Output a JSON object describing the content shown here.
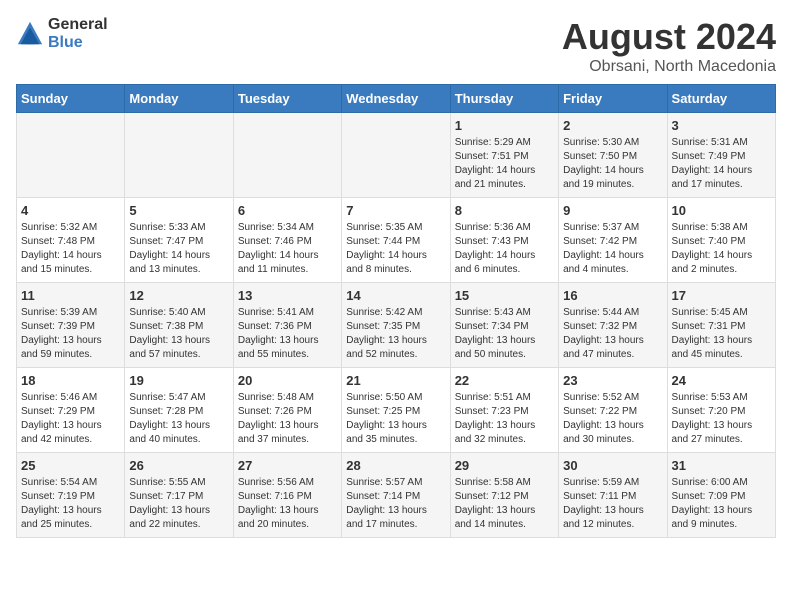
{
  "logo": {
    "general": "General",
    "blue": "Blue"
  },
  "title": "August 2024",
  "subtitle": "Obrsani, North Macedonia",
  "weekdays": [
    "Sunday",
    "Monday",
    "Tuesday",
    "Wednesday",
    "Thursday",
    "Friday",
    "Saturday"
  ],
  "weeks": [
    [
      {
        "day": "",
        "content": ""
      },
      {
        "day": "",
        "content": ""
      },
      {
        "day": "",
        "content": ""
      },
      {
        "day": "",
        "content": ""
      },
      {
        "day": "1",
        "content": "Sunrise: 5:29 AM\nSunset: 7:51 PM\nDaylight: 14 hours\nand 21 minutes."
      },
      {
        "day": "2",
        "content": "Sunrise: 5:30 AM\nSunset: 7:50 PM\nDaylight: 14 hours\nand 19 minutes."
      },
      {
        "day": "3",
        "content": "Sunrise: 5:31 AM\nSunset: 7:49 PM\nDaylight: 14 hours\nand 17 minutes."
      }
    ],
    [
      {
        "day": "4",
        "content": "Sunrise: 5:32 AM\nSunset: 7:48 PM\nDaylight: 14 hours\nand 15 minutes."
      },
      {
        "day": "5",
        "content": "Sunrise: 5:33 AM\nSunset: 7:47 PM\nDaylight: 14 hours\nand 13 minutes."
      },
      {
        "day": "6",
        "content": "Sunrise: 5:34 AM\nSunset: 7:46 PM\nDaylight: 14 hours\nand 11 minutes."
      },
      {
        "day": "7",
        "content": "Sunrise: 5:35 AM\nSunset: 7:44 PM\nDaylight: 14 hours\nand 8 minutes."
      },
      {
        "day": "8",
        "content": "Sunrise: 5:36 AM\nSunset: 7:43 PM\nDaylight: 14 hours\nand 6 minutes."
      },
      {
        "day": "9",
        "content": "Sunrise: 5:37 AM\nSunset: 7:42 PM\nDaylight: 14 hours\nand 4 minutes."
      },
      {
        "day": "10",
        "content": "Sunrise: 5:38 AM\nSunset: 7:40 PM\nDaylight: 14 hours\nand 2 minutes."
      }
    ],
    [
      {
        "day": "11",
        "content": "Sunrise: 5:39 AM\nSunset: 7:39 PM\nDaylight: 13 hours\nand 59 minutes."
      },
      {
        "day": "12",
        "content": "Sunrise: 5:40 AM\nSunset: 7:38 PM\nDaylight: 13 hours\nand 57 minutes."
      },
      {
        "day": "13",
        "content": "Sunrise: 5:41 AM\nSunset: 7:36 PM\nDaylight: 13 hours\nand 55 minutes."
      },
      {
        "day": "14",
        "content": "Sunrise: 5:42 AM\nSunset: 7:35 PM\nDaylight: 13 hours\nand 52 minutes."
      },
      {
        "day": "15",
        "content": "Sunrise: 5:43 AM\nSunset: 7:34 PM\nDaylight: 13 hours\nand 50 minutes."
      },
      {
        "day": "16",
        "content": "Sunrise: 5:44 AM\nSunset: 7:32 PM\nDaylight: 13 hours\nand 47 minutes."
      },
      {
        "day": "17",
        "content": "Sunrise: 5:45 AM\nSunset: 7:31 PM\nDaylight: 13 hours\nand 45 minutes."
      }
    ],
    [
      {
        "day": "18",
        "content": "Sunrise: 5:46 AM\nSunset: 7:29 PM\nDaylight: 13 hours\nand 42 minutes."
      },
      {
        "day": "19",
        "content": "Sunrise: 5:47 AM\nSunset: 7:28 PM\nDaylight: 13 hours\nand 40 minutes."
      },
      {
        "day": "20",
        "content": "Sunrise: 5:48 AM\nSunset: 7:26 PM\nDaylight: 13 hours\nand 37 minutes."
      },
      {
        "day": "21",
        "content": "Sunrise: 5:50 AM\nSunset: 7:25 PM\nDaylight: 13 hours\nand 35 minutes."
      },
      {
        "day": "22",
        "content": "Sunrise: 5:51 AM\nSunset: 7:23 PM\nDaylight: 13 hours\nand 32 minutes."
      },
      {
        "day": "23",
        "content": "Sunrise: 5:52 AM\nSunset: 7:22 PM\nDaylight: 13 hours\nand 30 minutes."
      },
      {
        "day": "24",
        "content": "Sunrise: 5:53 AM\nSunset: 7:20 PM\nDaylight: 13 hours\nand 27 minutes."
      }
    ],
    [
      {
        "day": "25",
        "content": "Sunrise: 5:54 AM\nSunset: 7:19 PM\nDaylight: 13 hours\nand 25 minutes."
      },
      {
        "day": "26",
        "content": "Sunrise: 5:55 AM\nSunset: 7:17 PM\nDaylight: 13 hours\nand 22 minutes."
      },
      {
        "day": "27",
        "content": "Sunrise: 5:56 AM\nSunset: 7:16 PM\nDaylight: 13 hours\nand 20 minutes."
      },
      {
        "day": "28",
        "content": "Sunrise: 5:57 AM\nSunset: 7:14 PM\nDaylight: 13 hours\nand 17 minutes."
      },
      {
        "day": "29",
        "content": "Sunrise: 5:58 AM\nSunset: 7:12 PM\nDaylight: 13 hours\nand 14 minutes."
      },
      {
        "day": "30",
        "content": "Sunrise: 5:59 AM\nSunset: 7:11 PM\nDaylight: 13 hours\nand 12 minutes."
      },
      {
        "day": "31",
        "content": "Sunrise: 6:00 AM\nSunset: 7:09 PM\nDaylight: 13 hours\nand 9 minutes."
      }
    ]
  ]
}
